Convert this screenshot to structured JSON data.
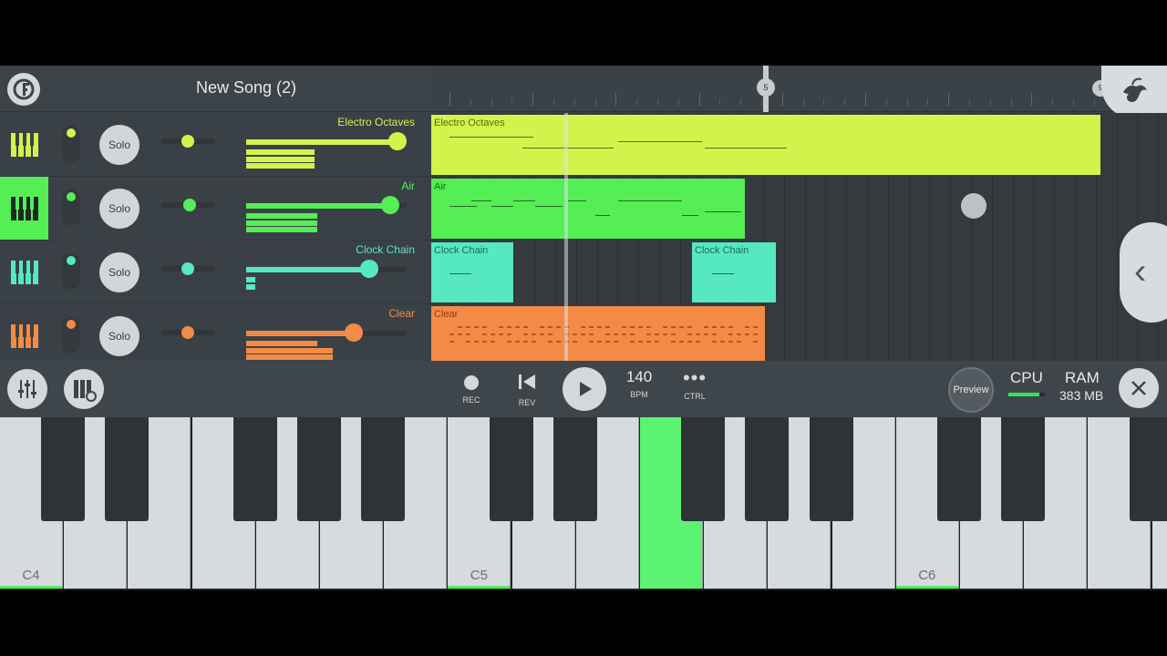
{
  "header": {
    "song_title": "New Song (2)",
    "timeline_markers": [
      "5",
      "9"
    ]
  },
  "tracks": [
    {
      "name": "Electro Octaves",
      "solo_label": "Solo",
      "color": "#d4f24c",
      "active": false,
      "volume": 0.92,
      "pan": 0.5,
      "clips": [
        {
          "label": "Electro Octaves"
        }
      ]
    },
    {
      "name": "Air",
      "solo_label": "Solo",
      "color": "#55ee55",
      "active": true,
      "volume": 0.9,
      "pan": 0.6,
      "clips": [
        {
          "label": "Air"
        }
      ]
    },
    {
      "name": "Clock Chain",
      "solo_label": "Solo",
      "color": "#56e8c1",
      "active": false,
      "volume": 0.76,
      "pan": 0.5,
      "clips": [
        {
          "label": "Clock Chain"
        },
        {
          "label": "Clock Chain"
        }
      ]
    },
    {
      "name": "Clear",
      "solo_label": "Solo",
      "color": "#f38a45",
      "active": false,
      "volume": 0.66,
      "pan": 0.5,
      "clips": [
        {
          "label": "Clear"
        }
      ]
    }
  ],
  "transport": {
    "rec_label": "REC",
    "rev_label": "REV",
    "bpm_value": "140",
    "bpm_label": "BPM",
    "ctrl_label": "CTRL",
    "preview_label": "Preview",
    "cpu_label": "CPU",
    "ram_label": "RAM",
    "ram_value": "383 MB"
  },
  "piano": {
    "octave_labels": {
      "c4": "C4",
      "c5": "C5",
      "c6": "C6"
    },
    "pressed_key": "F5"
  },
  "colors": {
    "electro": "#d4f24c",
    "air": "#55ee55",
    "clock": "#56e8c1",
    "clear": "#f38a45"
  }
}
